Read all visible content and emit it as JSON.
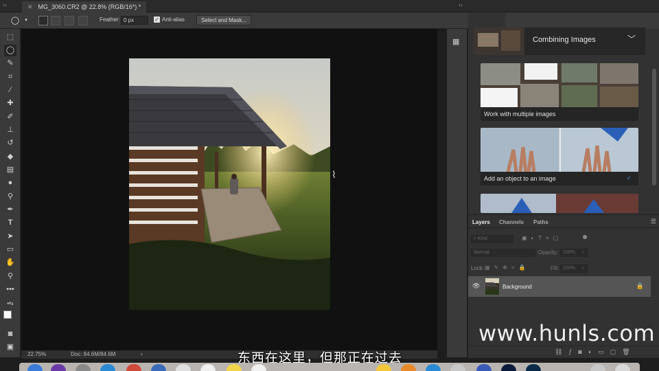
{
  "document_tab": {
    "title": "MG_3060.CR2 @ 22.8% (RGB/16*) *"
  },
  "options_bar": {
    "feather_label": "Feather:",
    "feather_value": "0 px",
    "anti_alias_label": "Anti-alias",
    "select_mask_label": "Select and Mask..."
  },
  "status_bar": {
    "zoom": "22.75%",
    "doc_size": "Doc: 84.6M/84.6M",
    "arrow": "›"
  },
  "learn_panel": {
    "title": "Combining Images",
    "cards": [
      {
        "label": "Work with multiple images",
        "completed": false
      },
      {
        "label": "Add an object to an image",
        "completed": true
      }
    ]
  },
  "layers_panel": {
    "tabs": [
      "Layers",
      "Channels",
      "Paths"
    ],
    "filter_placeholder": "Kind",
    "blend_mode": "Normal",
    "opacity_label": "Opacity:",
    "opacity_value": "100%",
    "lock_label": "Lock:",
    "fill_label": "Fill:",
    "fill_value": "100%",
    "layers": [
      {
        "name": "Background",
        "visible": true,
        "locked": true
      }
    ]
  },
  "watermark": "www.hunls.com",
  "subtitle": "东西在这里，但那正在过去",
  "colors": {
    "accent_blue": "#3d8ee6",
    "canvas_bg": "#111111",
    "panel_bg": "#323232"
  }
}
